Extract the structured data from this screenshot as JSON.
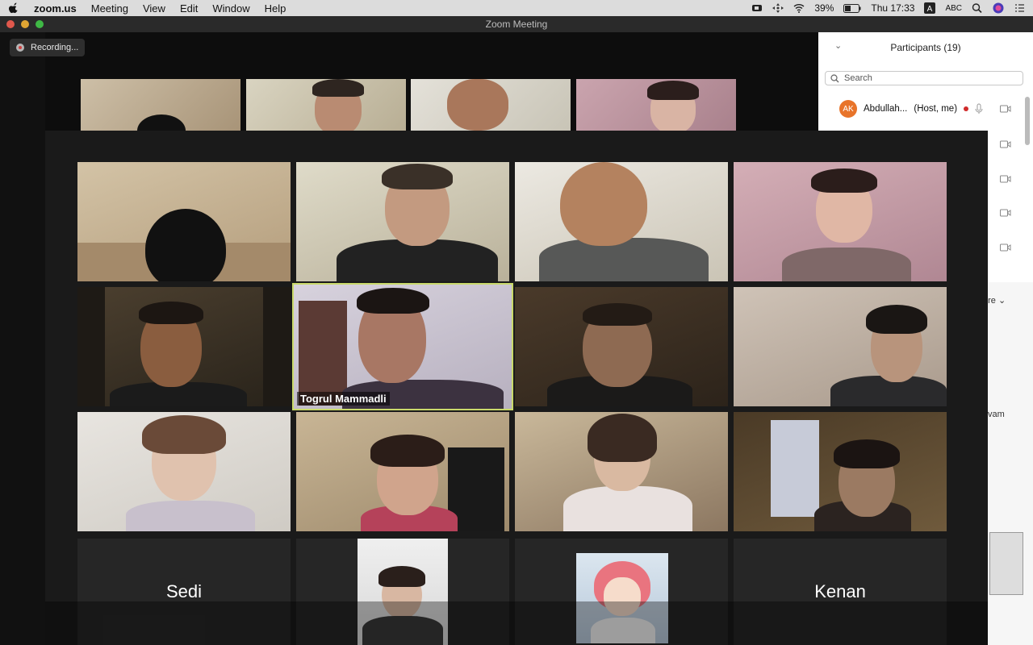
{
  "menubar": {
    "app": "zoom.us",
    "items": [
      "Meeting",
      "View",
      "Edit",
      "Window",
      "Help"
    ],
    "battery": "39%",
    "clock": "Thu 17:33",
    "input_source": "ABC"
  },
  "window": {
    "title": "Zoom Meeting"
  },
  "recording": {
    "label": "Recording..."
  },
  "participants_panel": {
    "title": "Participants (19)",
    "search_placeholder": "Search",
    "host_name": "Abdullah...",
    "host_tag": "(Host, me)",
    "host_initials": "AK",
    "more_label": "ore",
    "partial_text": "vam"
  },
  "video_grid": {
    "active_speaker": "Togrul Mammadli",
    "name_tiles": [
      "Sedi",
      "Kenan"
    ]
  },
  "colors": {
    "active_border": "#c9d96b",
    "avatar_orange": "#e8742a"
  }
}
